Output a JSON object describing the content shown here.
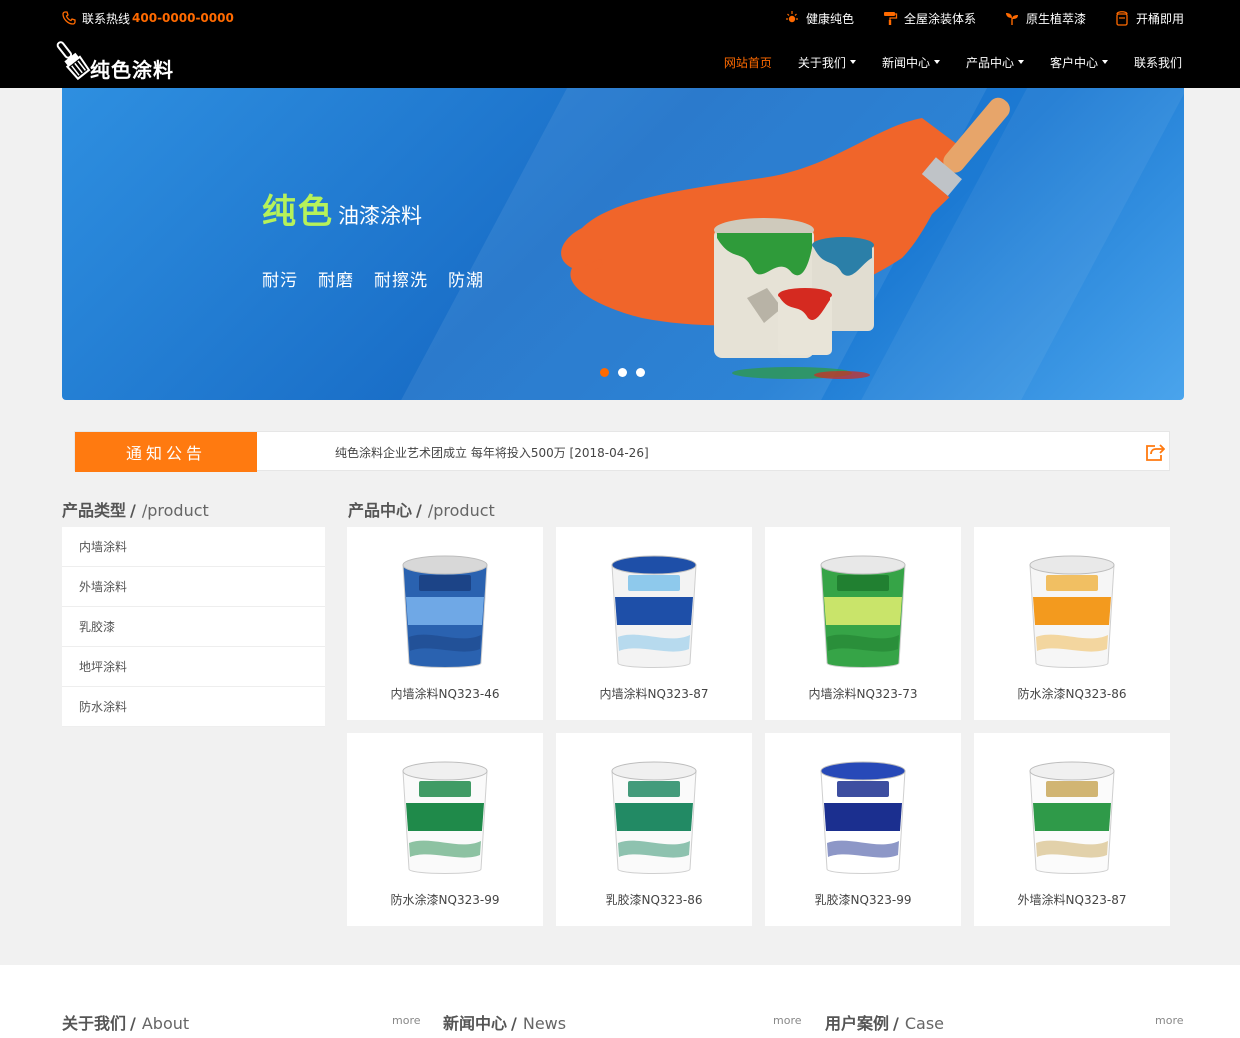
{
  "header": {
    "hotline_label": "联系热线",
    "hotline_number": "400-0000-0000",
    "top_links": [
      "健康纯色",
      "全屋涂装体系",
      "原生植萃漆",
      "开桶即用"
    ],
    "logo_text": "纯色涂料",
    "nav": [
      {
        "label": "网站首页",
        "active": true,
        "dropdown": false
      },
      {
        "label": "关于我们",
        "active": false,
        "dropdown": true
      },
      {
        "label": "新闻中心",
        "active": false,
        "dropdown": true
      },
      {
        "label": "产品中心",
        "active": false,
        "dropdown": true
      },
      {
        "label": "客户中心",
        "active": false,
        "dropdown": true
      },
      {
        "label": "联系我们",
        "active": false,
        "dropdown": false
      }
    ]
  },
  "banner": {
    "title_main": "纯色",
    "title_sub": "油漆涂料",
    "slogans": [
      "耐污",
      "耐磨",
      "耐擦洗",
      "防潮"
    ],
    "slides": 3,
    "active_slide": 0
  },
  "notice": {
    "label": "通知公告",
    "text": "纯色涂料企业艺术团成立 每年将投入500万 [2018-04-26]"
  },
  "sidebar": {
    "title_zh": "产品类型",
    "title_en": "/product",
    "items": [
      "内墙涂料",
      "外墙涂料",
      "乳胶漆",
      "地坪涂料",
      "防水涂料"
    ]
  },
  "products": {
    "title_zh": "产品中心",
    "title_en": "/product",
    "items": [
      {
        "name": "内墙涂料NQ323-46"
      },
      {
        "name": "内墙涂料NQ323-87"
      },
      {
        "name": "内墙涂料NQ323-73"
      },
      {
        "name": "防水涂漆NQ323-86"
      },
      {
        "name": "防水涂漆NQ323-99"
      },
      {
        "name": "乳胶漆NQ323-86"
      },
      {
        "name": "乳胶漆NQ323-99"
      },
      {
        "name": "外墙涂料NQ323-87"
      }
    ]
  },
  "bottom": {
    "sections": [
      {
        "zh": "关于我们",
        "en": "About",
        "more": "more"
      },
      {
        "zh": "新闻中心",
        "en": "News",
        "more": "more"
      },
      {
        "zh": "用户案例",
        "en": "Case",
        "more": "more"
      }
    ]
  },
  "colors": {
    "accent": "#ff6a00",
    "header_bg": "#000000",
    "banner_blue": "#1a6fc8",
    "lime": "#b6f25a"
  }
}
